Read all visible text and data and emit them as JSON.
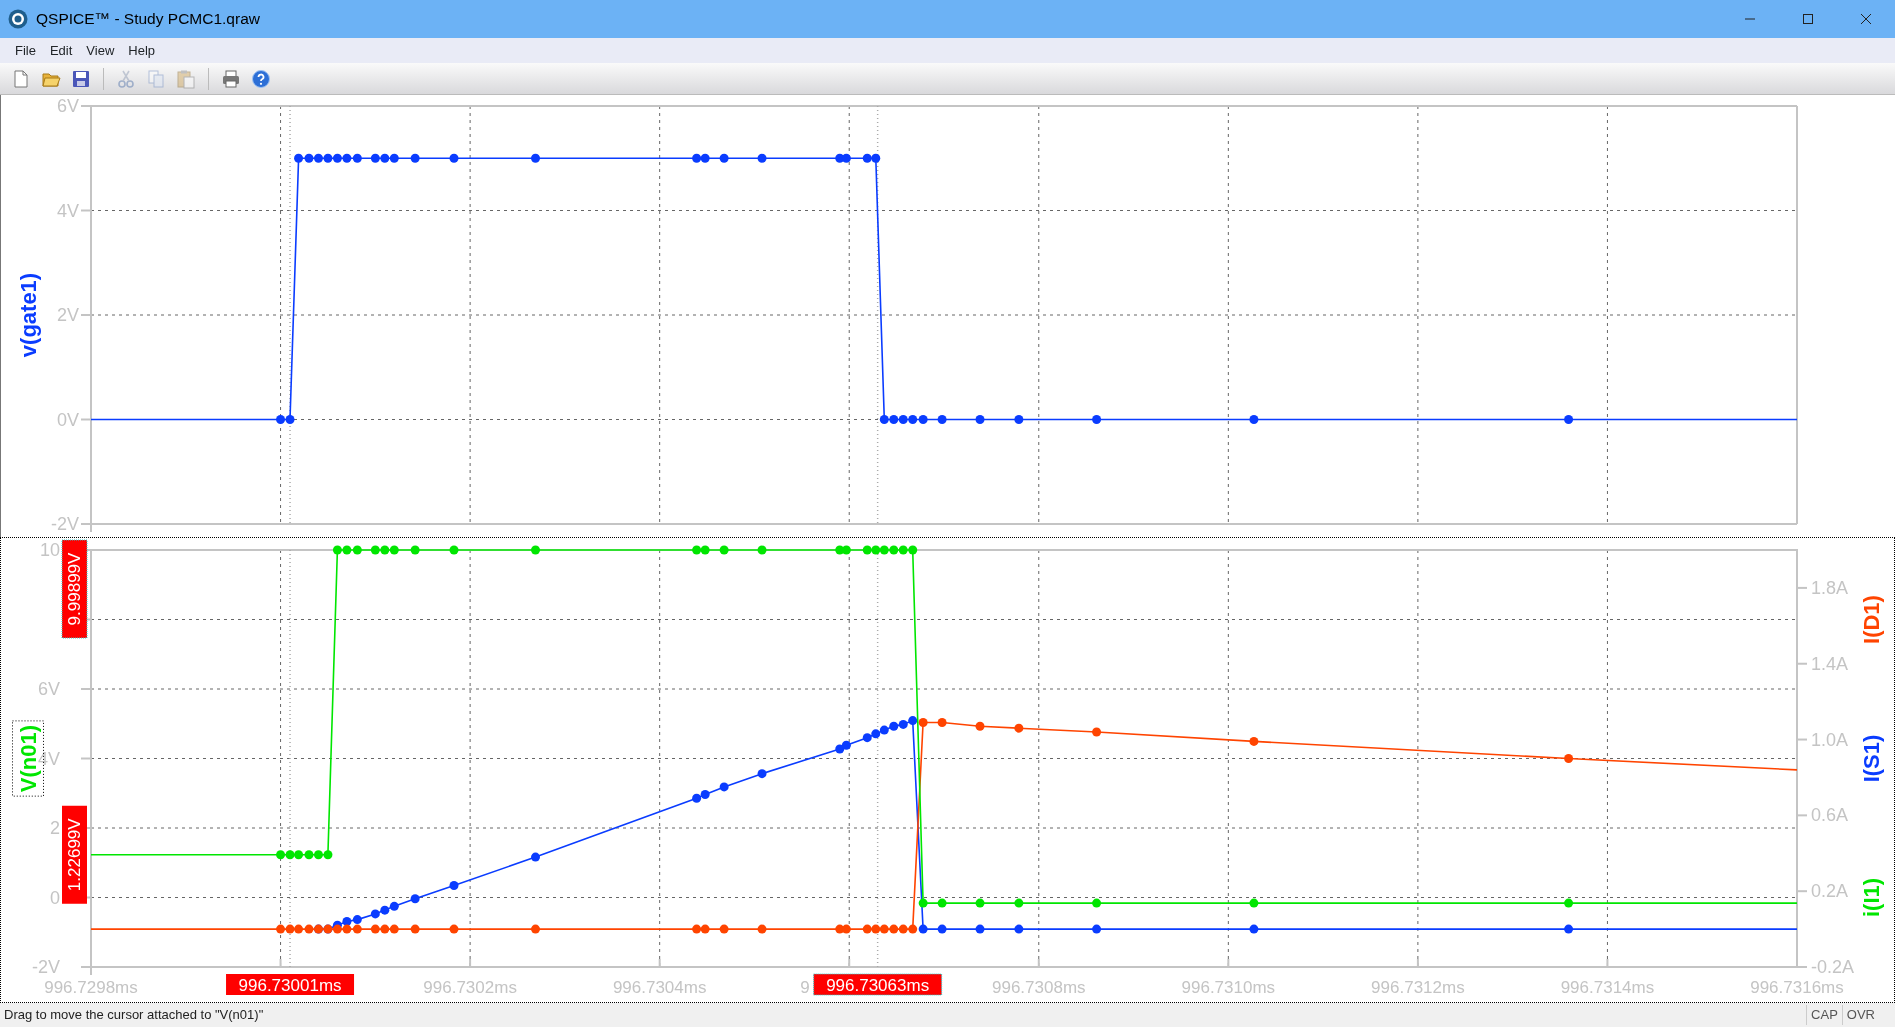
{
  "window": {
    "title": "QSPICE™ - Study PCMC1.qraw"
  },
  "menu": [
    "File",
    "Edit",
    "View",
    "Help"
  ],
  "toolbar": [
    {
      "kind": "new",
      "disabled": false
    },
    {
      "kind": "open",
      "disabled": false
    },
    {
      "kind": "save",
      "disabled": false
    },
    {
      "kind": "separator"
    },
    {
      "kind": "cut",
      "disabled": true
    },
    {
      "kind": "copy",
      "disabled": true
    },
    {
      "kind": "paste",
      "disabled": true
    },
    {
      "kind": "separator"
    },
    {
      "kind": "print",
      "disabled": false
    },
    {
      "kind": "help",
      "disabled": false
    }
  ],
  "plots": [
    {
      "trace_labels": [
        {
          "selected": false
        }
      ],
      "chart_data": {
        "type": "line",
        "x": [
          996.7298,
          996.73,
          996.73001,
          996.730019,
          996.73003,
          996.73004,
          996.73005,
          996.73006,
          996.73007,
          996.730081,
          996.7301,
          996.73011,
          996.73012,
          996.730142,
          996.730183,
          996.730269,
          996.730439,
          996.730448,
          996.730468,
          996.730508,
          996.73059,
          996.730597,
          996.730619,
          996.730628,
          996.730637,
          996.730647,
          996.730657,
          996.730667,
          996.730678,
          996.730698,
          996.730738,
          996.730779,
          996.730861,
          996.731027,
          996.731359,
          996.7316
        ],
        "grid": true,
        "series": [
          {
            "name": "v(gate1)",
            "color": "#0a3cff",
            "marker": "circle",
            "values": [
              0,
              0,
              0,
              5,
              5,
              5,
              5,
              5,
              5,
              5,
              5,
              5,
              5,
              5,
              5,
              5,
              5,
              5,
              5,
              5,
              5,
              5,
              5,
              5,
              0,
              0,
              0,
              0,
              0,
              0,
              0,
              0,
              0,
              0,
              0,
              0
            ]
          }
        ],
        "xlim": [
          996.7298,
          996.7316
        ],
        "ylim": [
          -2,
          6
        ],
        "yticks": [
          {
            "value": 6,
            "label": "6V"
          },
          {
            "value": 4,
            "label": "4V"
          },
          {
            "value": 2,
            "label": "2V"
          },
          {
            "value": 0,
            "label": "0V"
          },
          {
            "value": -2,
            "label": "-2V"
          }
        ],
        "ref_lines": [
          {
            "axis": "x",
            "value": 996.73001
          },
          {
            "axis": "x",
            "value": 996.73063
          }
        ]
      }
    },
    {
      "trace_labels": [
        {
          "selected": true
        },
        {
          "selected": false
        },
        {
          "selected": false
        },
        {
          "text": "i(I1)",
          "color": "#00e600",
          "selected": false
        }
      ],
      "cursors": [
        {
          "value": "1.22699V",
          "selected": false
        },
        {
          "value": "9.99899V",
          "selected": true
        }
      ],
      "partial_tick_label": "9",
      "chart_data": {
        "type": "line",
        "x": [
          996.7298,
          996.73,
          996.73001,
          996.730019,
          996.73003,
          996.73004,
          996.73005,
          996.73006,
          996.73007,
          996.730081,
          996.7301,
          996.73011,
          996.73012,
          996.730142,
          996.730183,
          996.730269,
          996.730439,
          996.730448,
          996.730468,
          996.730508,
          996.73059,
          996.730597,
          996.730619,
          996.730628,
          996.730637,
          996.730647,
          996.730657,
          996.730667,
          996.730678,
          996.730698,
          996.730738,
          996.730779,
          996.730861,
          996.731027,
          996.731359,
          996.7316
        ],
        "grid": true,
        "series": [
          {
            "name": "V(n01)",
            "color": "#00e600",
            "marker": "circle",
            "values": [
              1.23,
              1.23,
              1.23,
              1.23,
              1.23,
              1.23,
              1.23,
              10,
              10,
              10,
              10,
              10,
              10,
              10,
              10,
              10,
              10,
              10,
              10,
              10,
              10,
              10,
              10,
              10,
              10,
              10,
              10,
              10,
              -0.16,
              -0.16,
              -0.16,
              -0.16,
              -0.16,
              -0.16,
              -0.16,
              -0.16
            ]
          },
          {
            "name": "I(D1)",
            "color": "#ff4400",
            "axis": "y2",
            "marker": "circle",
            "values": [
              0,
              0,
              0,
              0,
              0,
              0,
              0,
              0,
              0,
              0,
              0,
              0,
              0,
              0,
              0,
              0,
              0,
              0,
              0,
              0,
              0,
              0,
              0,
              0,
              0,
              0,
              0,
              0,
              1.09,
              1.09,
              1.07,
              1.06,
              1.04,
              0.99,
              0.9,
              0.84
            ]
          },
          {
            "name": "I(S1)",
            "color": "#0a3cff",
            "axis": "y2",
            "marker": "circle",
            "values": [
              null,
              null,
              null,
              null,
              null,
              0,
              0,
              0.02,
              0.04,
              0.05,
              0.08,
              0.1,
              0.12,
              0.16,
              0.23,
              0.38,
              0.69,
              0.71,
              0.75,
              0.82,
              0.95,
              0.97,
              1.01,
              1.03,
              1.05,
              1.07,
              1.08,
              1.1,
              0,
              0,
              0,
              0,
              0,
              0,
              0,
              0
            ]
          }
        ],
        "xlim": [
          996.7298,
          996.7316
        ],
        "ylim": [
          -2,
          10
        ],
        "y2lim": [
          -0.2,
          2.0
        ],
        "xticks": [
          {
            "value": 996.7298,
            "label": "996.7298ms"
          },
          {
            "value": 996.7302,
            "label": "996.7302ms"
          },
          {
            "value": 996.7304,
            "label": "996.7304ms"
          },
          {
            "value": 996.7308,
            "label": "996.7308ms"
          },
          {
            "value": 996.731,
            "label": "996.7310ms"
          },
          {
            "value": 996.7312,
            "label": "996.7312ms"
          },
          {
            "value": 996.7314,
            "label": "996.7314ms"
          },
          {
            "value": 996.7316,
            "label": "996.7316ms"
          }
        ],
        "yticks": [
          {
            "value": 10,
            "label": "10"
          },
          {
            "value": 6,
            "label": "6V"
          },
          {
            "value": 4,
            "label": "4V"
          },
          {
            "value": 2,
            "label": "2"
          },
          {
            "value": 0,
            "label": "0"
          },
          {
            "value": -2,
            "label": "-2V"
          }
        ],
        "y2ticks": [
          {
            "value": 1.8,
            "label": "1.8A"
          },
          {
            "value": 1.4,
            "label": "1.4A"
          },
          {
            "value": 1.0,
            "label": "1.0A"
          },
          {
            "value": 0.6,
            "label": "0.6A"
          },
          {
            "value": 0.2,
            "label": "0.2A"
          },
          {
            "value": -0.2,
            "label": "-0.2A"
          }
        ],
        "ref_lines": [
          {
            "axis": "x",
            "value": 996.73001,
            "label": "996.73001ms"
          },
          {
            "axis": "x",
            "value": 996.73063,
            "label": "996.73063ms"
          }
        ]
      }
    }
  ],
  "status_bar": {
    "message": "Drag to move the cursor attached to \"V(n01)\"",
    "indicators": [
      "CAP",
      "OVR"
    ]
  }
}
